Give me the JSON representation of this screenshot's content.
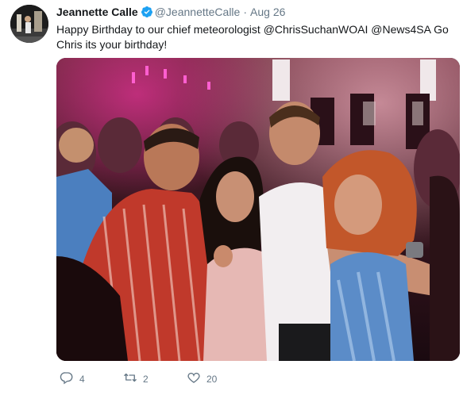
{
  "tweet": {
    "author_name": "Jeannette Calle",
    "handle": "@JeannetteCalle",
    "separator": "·",
    "date": "Aug 26",
    "text": "Happy Birthday to our chief meteorologist @ChrisSuchanWOAI @News4SA Go Chris its your birthday!"
  },
  "actions": {
    "reply_icon": "reply-icon",
    "reply_count": "4",
    "retweet_icon": "retweet-icon",
    "retweet_count": "2",
    "like_icon": "heart-icon",
    "like_count": "20"
  },
  "colors": {
    "text": "#14171a",
    "muted": "#657786",
    "verified": "#1da1f2"
  }
}
